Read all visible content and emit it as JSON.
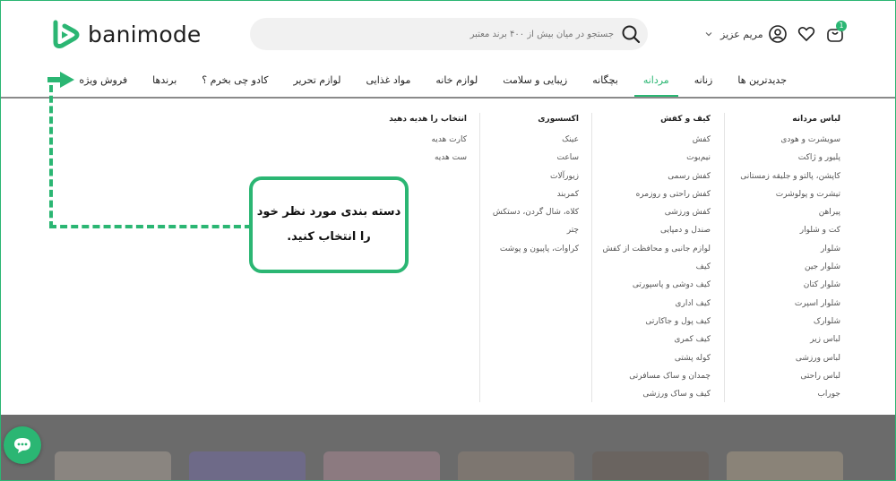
{
  "brand": {
    "name": "banimode",
    "accent": "#2bb673"
  },
  "search": {
    "placeholder": "جستجو در میان بیش از ۴۰۰ برند معتبر"
  },
  "user": {
    "name": "مریم عزیز",
    "cart_count": "1"
  },
  "nav": {
    "items": [
      {
        "label": "جدیدترین ها"
      },
      {
        "label": "زنانه"
      },
      {
        "label": "مردانه",
        "active": true
      },
      {
        "label": "بچگانه"
      },
      {
        "label": "زیبایی و سلامت"
      },
      {
        "label": "لوازم خانه"
      },
      {
        "label": "مواد غذایی"
      },
      {
        "label": "لوازم تحریر"
      },
      {
        "label": "کادو چی بخرم ؟"
      },
      {
        "label": "برندها"
      },
      {
        "label": "فروش ویژه"
      }
    ]
  },
  "mega_menu": {
    "columns": [
      {
        "title": "لباس مردانه",
        "items": [
          "سویشرت و هودی",
          "پلیور و ژاکت",
          "کاپشن، پالتو و جلیقه زمستانی",
          "تیشرت و پولوشرت",
          "پیراهن",
          "کت و شلوار",
          "شلوار",
          "شلوار جین",
          "شلوار کتان",
          "شلوار اسپرت",
          "شلوارک",
          "لباس زیر",
          "لباس ورزشی",
          "لباس راحتی",
          "جوراب"
        ]
      },
      {
        "title": "کیف و کفش",
        "items": [
          "کفش",
          "نیم‌بوت",
          "کفش رسمی",
          "کفش راحتی و روزمره",
          "کفش ورزشی",
          "صندل و دمپایی",
          "لوازم جانبی و محافظت از کفش",
          "کیف",
          "کیف دوشی و پاسپورتی",
          "کیف اداری",
          "کیف پول و جاکارتی",
          "کیف کمری",
          "کوله پشتی",
          "چمدان و ساک مسافرتی",
          "کیف و ساک ورزشی"
        ]
      },
      {
        "title": "اکسسوری",
        "items": [
          "عینک",
          "ساعت",
          "زیورآلات",
          "کمربند",
          "کلاه، شال گردن، دستکش",
          "چتر",
          "کراوات، پاپیون و پوشت"
        ]
      },
      {
        "title": "انتخاب را هدیه دهید",
        "items": [
          "کارت هدیه",
          "ست هدیه"
        ]
      }
    ]
  },
  "annotation": {
    "line1": "دسته بندی مورد نظر خود",
    "line2": "را انتخاب کنید."
  },
  "icons": [
    "search-icon",
    "chevron-down-icon",
    "user-icon",
    "heart-icon",
    "cart-icon",
    "chat-icon",
    "arrow-right-icon"
  ]
}
